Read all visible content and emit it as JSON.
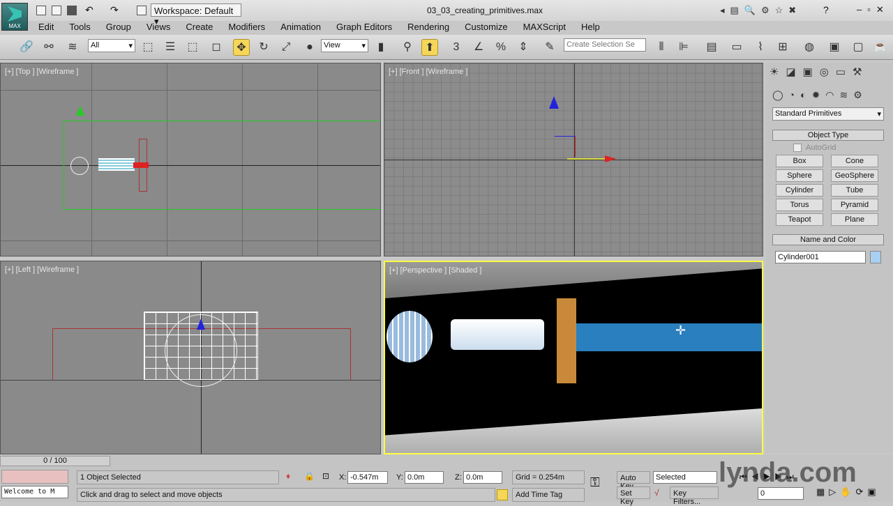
{
  "app": {
    "logo_label": "MAX",
    "workspace": "Workspace: Default",
    "file_title": "03_03_creating_primitives.max"
  },
  "menu": [
    "Edit",
    "Tools",
    "Group",
    "Views",
    "Create",
    "Modifiers",
    "Animation",
    "Graph Editors",
    "Rendering",
    "Customize",
    "MAXScript",
    "Help"
  ],
  "toolbar": {
    "selection_filter": "All",
    "ref_coord": "View",
    "snap_label": "3",
    "named_selection_placeholder": "Create Selection Se"
  },
  "viewports": {
    "top": "[+] [Top ] [Wireframe ]",
    "front": "[+] [Front ] [Wireframe ]",
    "left": "[+] [Left ] [Wireframe ]",
    "perspective": "[+] [Perspective ] [Shaded ]"
  },
  "panel": {
    "category": "Standard Primitives",
    "object_type": "Object Type",
    "autogrid": "AutoGrid",
    "buttons": [
      "Box",
      "Cone",
      "Sphere",
      "GeoSphere",
      "Cylinder",
      "Tube",
      "Torus",
      "Pyramid",
      "Teapot",
      "Plane"
    ],
    "name_color": "Name and Color",
    "object_name": "Cylinder001",
    "color": "#a8d0f0"
  },
  "timeline": {
    "frame": "0 / 100"
  },
  "status": {
    "welcome": "Welcome to M",
    "selected": "1 Object Selected",
    "prompt": "Click and drag to select and move objects",
    "x_label": "X:",
    "x": "-0.547m",
    "y_label": "Y:",
    "y": "0.0m",
    "z_label": "Z:",
    "z": "0.0m",
    "grid": "Grid = 0.254m",
    "add_time_tag": "Add Time Tag",
    "auto_key": "Auto Key",
    "set_key": "Set Key",
    "key_mode": "Selected",
    "key_filters": "Key Filters...",
    "current_frame": "0"
  },
  "watermark": "lynda.com"
}
